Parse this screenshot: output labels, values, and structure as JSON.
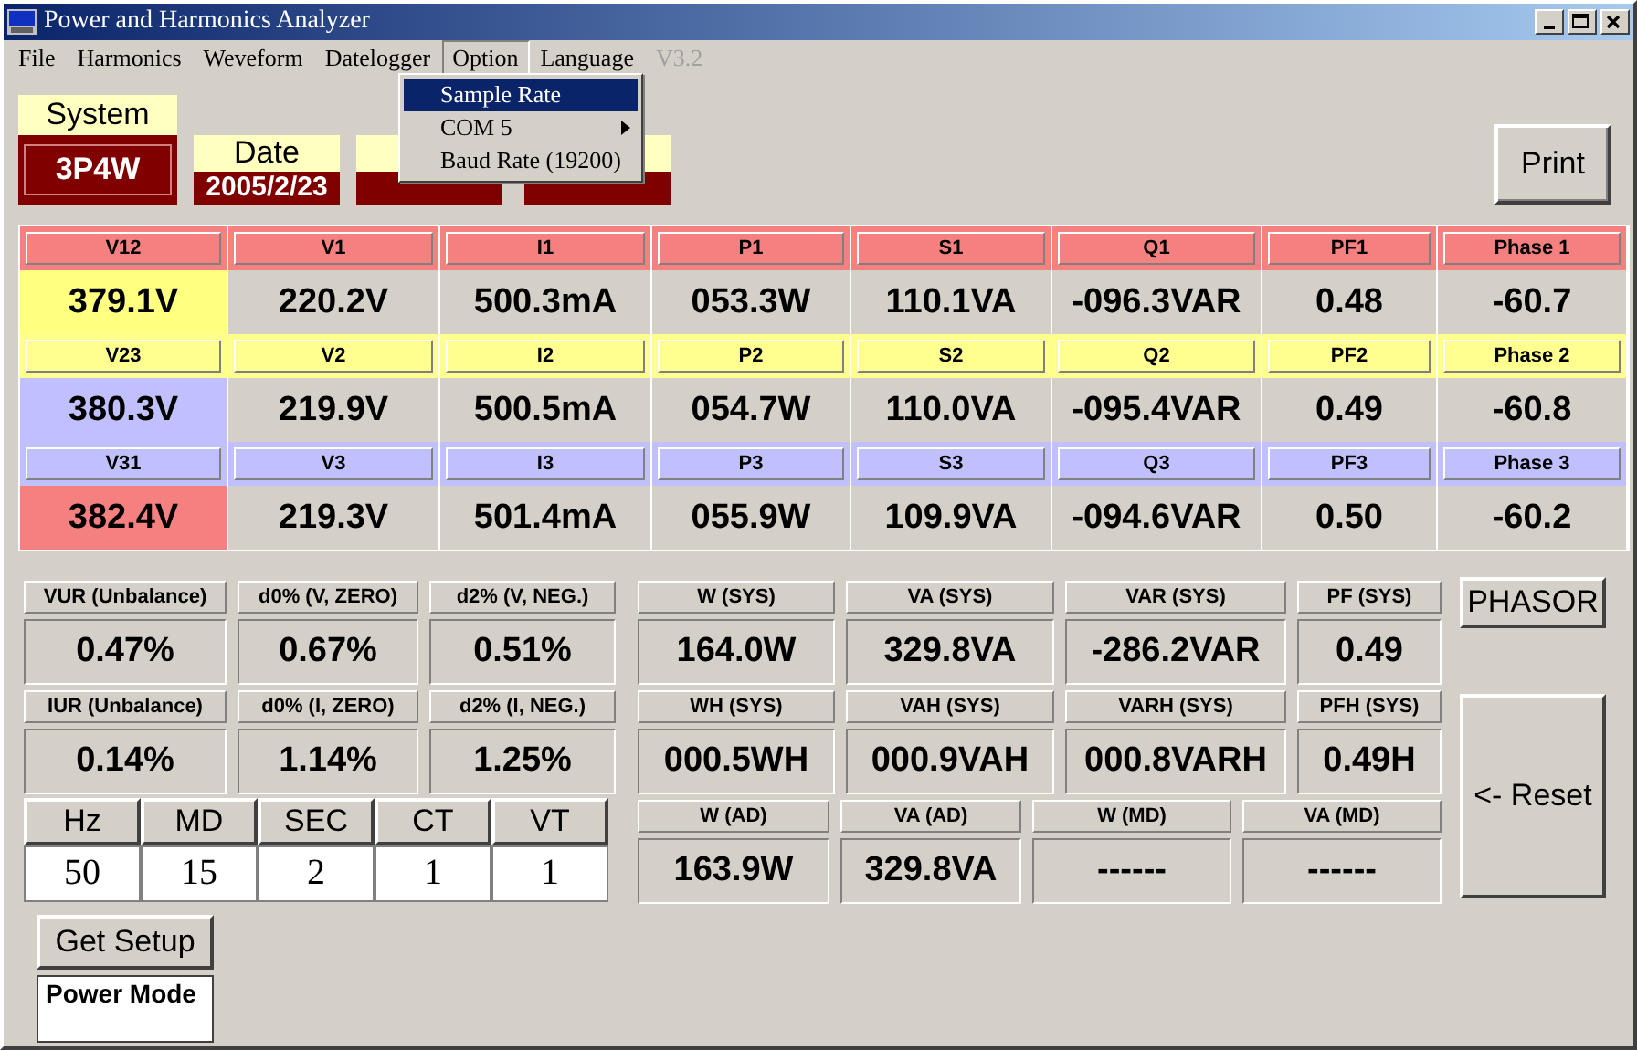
{
  "window": {
    "title": "Power and Harmonics Analyzer"
  },
  "menu": [
    {
      "label": "File",
      "selected": false,
      "disabled": false
    },
    {
      "label": "Harmonics",
      "selected": false,
      "disabled": false
    },
    {
      "label": "Weveform",
      "selected": false,
      "disabled": false
    },
    {
      "label": "Datelogger",
      "selected": false,
      "disabled": false
    },
    {
      "label": "Option",
      "selected": true,
      "disabled": false
    },
    {
      "label": "Language",
      "selected": false,
      "disabled": false
    },
    {
      "label": "V3.2",
      "selected": false,
      "disabled": true
    }
  ],
  "dropdown": [
    {
      "label": "Sample Rate",
      "selected": true,
      "submenu": false
    },
    {
      "label": "COM 5",
      "selected": false,
      "submenu": true
    },
    {
      "label": "Baud Rate (19200)",
      "selected": false,
      "submenu": false
    }
  ],
  "cards": [
    {
      "kind": "system",
      "label": "System",
      "value": "3P4W"
    },
    {
      "kind": "small",
      "label": "Date",
      "value": "2005/2/23"
    },
    {
      "kind": "covered"
    },
    {
      "kind": "covered"
    }
  ],
  "print_button": "Print",
  "phase_table": {
    "rows": [
      {
        "color": "#f48080",
        "highlight": {
          "color": "#ffff80"
        },
        "headers": [
          "V12",
          "V1",
          "I1",
          "P1",
          "S1",
          "Q1",
          "PF1",
          "Phase 1"
        ],
        "values": [
          "379.1V",
          "220.2V",
          "500.3mA",
          "053.3W",
          "110.1VA",
          "-096.3VAR",
          "0.48",
          "-60.7"
        ]
      },
      {
        "color": "#ffff90",
        "highlight": {
          "color": "#c0c0ff"
        },
        "headers": [
          "V23",
          "V2",
          "I2",
          "P2",
          "S2",
          "Q2",
          "PF2",
          "Phase 2"
        ],
        "values": [
          "380.3V",
          "219.9V",
          "500.5mA",
          "054.7W",
          "110.0VA",
          "-095.4VAR",
          "0.49",
          "-60.8"
        ]
      },
      {
        "color": "#c0c0ff",
        "highlight": {
          "color": "#f48080"
        },
        "headers": [
          "V31",
          "V3",
          "I3",
          "P3",
          "S3",
          "Q3",
          "PF3",
          "Phase 3"
        ],
        "values": [
          "382.4V",
          "219.3V",
          "501.4mA",
          "055.9W",
          "109.9VA",
          "-094.6VAR",
          "0.50",
          "-60.2"
        ]
      }
    ]
  },
  "unbalance": [
    {
      "headers": [
        "VUR (Unbalance)",
        "d0% (V, ZERO)",
        "d2% (V, NEG.)"
      ],
      "values": [
        "0.47%",
        "0.67%",
        "0.51%"
      ]
    },
    {
      "headers": [
        "IUR (Unbalance)",
        "d0% (I, ZERO)",
        "d2% (I, NEG.)"
      ],
      "values": [
        "0.14%",
        "1.14%",
        "1.25%"
      ]
    }
  ],
  "setup": [
    {
      "label": "Hz",
      "value": "50"
    },
    {
      "label": "MD",
      "value": "15"
    },
    {
      "label": "SEC",
      "value": "2"
    },
    {
      "label": "CT",
      "value": "1"
    },
    {
      "label": "VT",
      "value": "1"
    }
  ],
  "system_table": [
    {
      "headers": [
        "W (SYS)",
        "VA (SYS)",
        "VAR (SYS)",
        "PF (SYS)"
      ],
      "values": [
        "164.0W",
        "329.8VA",
        "-286.2VAR",
        "0.49"
      ]
    },
    {
      "headers": [
        "WH (SYS)",
        "VAH (SYS)",
        "VARH (SYS)",
        "PFH (SYS)"
      ],
      "values": [
        "000.5WH",
        "000.9VAH",
        "000.8VARH",
        "0.49H"
      ]
    },
    {
      "headers": [
        "W (AD)",
        "VA (AD)",
        "W (MD)",
        "VA (MD)"
      ],
      "values": [
        "163.9W",
        "329.8VA",
        "------",
        "------"
      ]
    }
  ],
  "phasor_button": "PHASOR",
  "reset_button": "<- Reset",
  "get_setup_button": "Get Setup",
  "mode_box": "Power Mode"
}
